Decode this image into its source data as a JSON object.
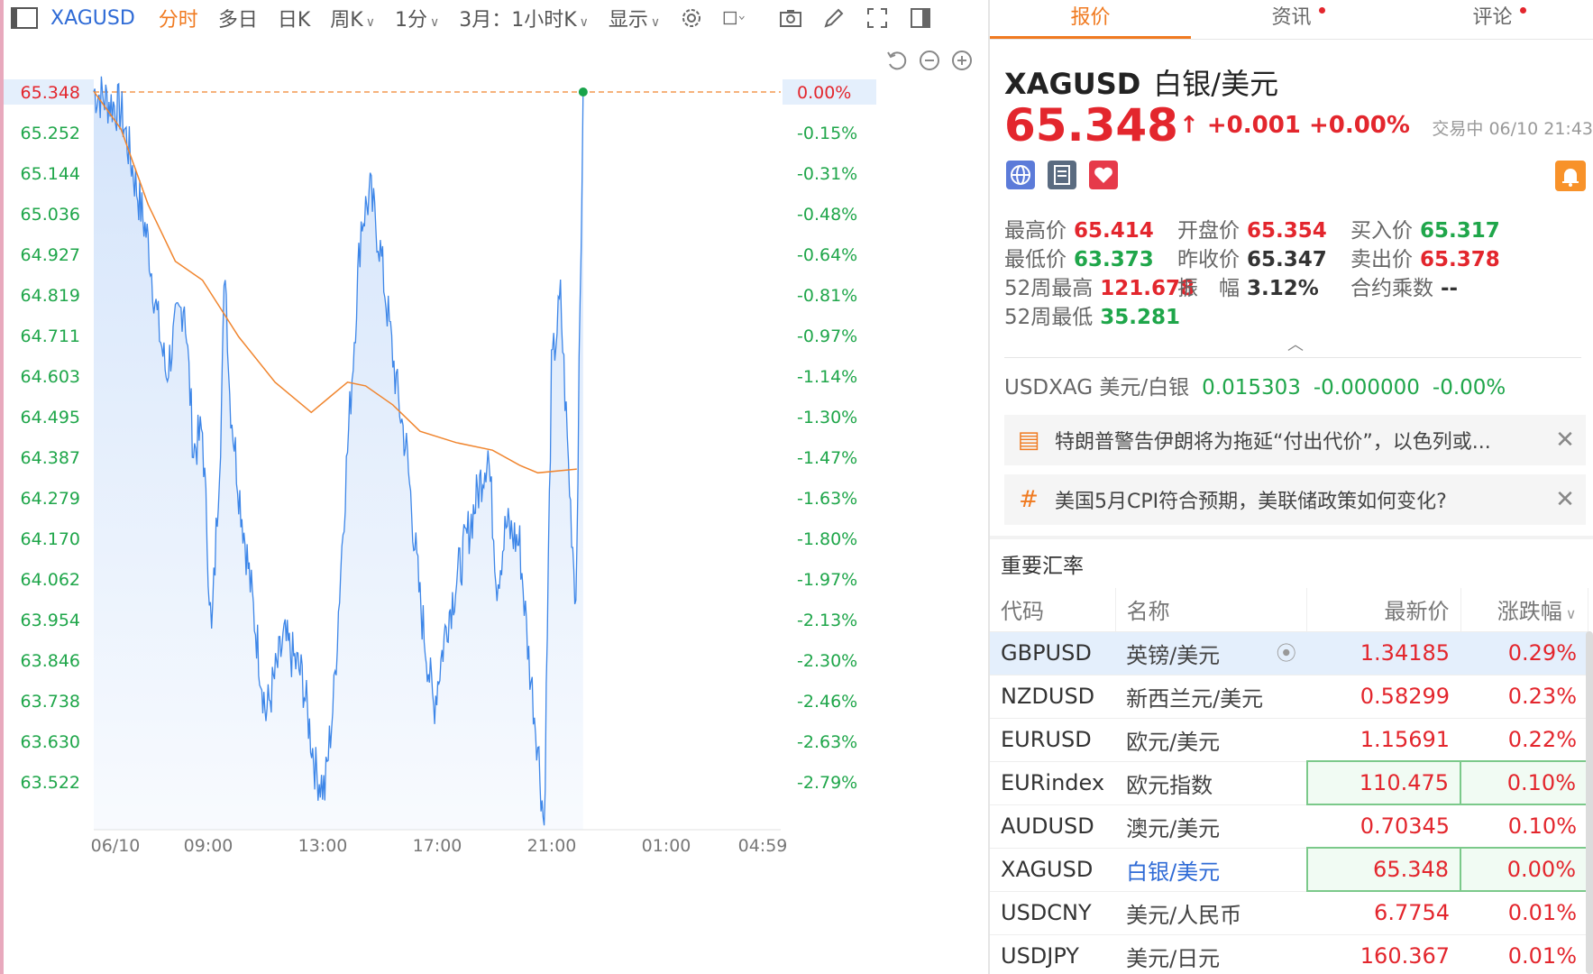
{
  "toolbar": {
    "symbol": "XAGUSD",
    "items": [
      "分时",
      "多日",
      "日K",
      "周K",
      "1分",
      "3月：1小时K",
      "显示"
    ],
    "active_index": 0
  },
  "chart": {
    "price_labels": [
      "65.348",
      "65.252",
      "65.144",
      "65.036",
      "64.927",
      "64.819",
      "64.711",
      "64.603",
      "64.495",
      "64.387",
      "64.279",
      "64.170",
      "64.062",
      "63.954",
      "63.846",
      "63.738",
      "63.630",
      "63.522"
    ],
    "pct_labels": [
      "0.00%",
      "-0.15%",
      "-0.31%",
      "-0.48%",
      "-0.64%",
      "-0.81%",
      "-0.97%",
      "-1.14%",
      "-1.30%",
      "-1.47%",
      "-1.63%",
      "-1.80%",
      "-1.97%",
      "-2.13%",
      "-2.30%",
      "-2.46%",
      "-2.63%",
      "-2.79%"
    ],
    "time_labels": [
      "06/10",
      "09:00",
      "13:00",
      "17:00",
      "21:00",
      "01:00",
      "04:59"
    ],
    "colors": {
      "line": "#3d86e8",
      "avg": "#f0852e",
      "up": "#e3262d",
      "down": "#1fa64a",
      "fill": "#cfe1fa"
    }
  },
  "panel": {
    "tabs": [
      {
        "label": "报价",
        "active": true,
        "dot": false
      },
      {
        "label": "资讯",
        "active": false,
        "dot": true
      },
      {
        "label": "评论",
        "active": false,
        "dot": true
      }
    ],
    "quote": {
      "symbol": "XAGUSD",
      "name": "白银/美元",
      "price": "65.348",
      "arrow": "↑",
      "change": "+0.001",
      "change_pct": "+0.00%",
      "status": "交易中 06/10 21:43"
    },
    "stats": [
      {
        "label": "最高价",
        "value": "65.414",
        "tone": "up"
      },
      {
        "label": "开盘价",
        "value": "65.354",
        "tone": "up"
      },
      {
        "label": "买入价",
        "value": "65.317",
        "tone": "down"
      },
      {
        "label": "最低价",
        "value": "63.373",
        "tone": "down"
      },
      {
        "label": "昨收价",
        "value": "65.347",
        "tone": "neutral"
      },
      {
        "label": "卖出价",
        "value": "65.378",
        "tone": "up"
      },
      {
        "label": "52周最高",
        "value": "121.678",
        "tone": "up"
      },
      {
        "label": "振　幅",
        "value": "3.12%",
        "tone": "neutral"
      },
      {
        "label": "合约乘数",
        "value": "--",
        "tone": "neutral"
      },
      {
        "label": "52周最低",
        "value": "35.281",
        "tone": "down"
      }
    ],
    "usdxag": {
      "label": "USDXAG 美元/白银",
      "price": "0.015303",
      "change": "-0.000000",
      "pct": "-0.00%"
    },
    "news": [
      {
        "text": "特朗普警告伊朗将为拖延“付出代价”，以色列或...",
        "icon": "document-icon"
      },
      {
        "text": "美国5月CPI符合预期，美联储政策如何变化?",
        "icon": "hashtag-icon"
      }
    ],
    "rates": {
      "title": "重要汇率",
      "headers": [
        "代码",
        "名称",
        "最新价",
        "涨跌幅"
      ],
      "rows": [
        {
          "code": "GBPUSD",
          "name": "英镑/美元",
          "price": "1.34185",
          "pct": "0.29%",
          "selected": true
        },
        {
          "code": "NZDUSD",
          "name": "新西兰元/美元",
          "price": "0.58299",
          "pct": "0.23%"
        },
        {
          "code": "EURUSD",
          "name": "欧元/美元",
          "price": "1.15691",
          "pct": "0.22%"
        },
        {
          "code": "EURindex",
          "name": "欧元指数",
          "price": "110.475",
          "pct": "0.10%",
          "highlight": true
        },
        {
          "code": "AUDUSD",
          "name": "澳元/美元",
          "price": "0.70345",
          "pct": "0.10%"
        },
        {
          "code": "XAGUSD",
          "name": "白银/美元",
          "price": "65.348",
          "pct": "0.00%",
          "highlight": true,
          "link": true
        },
        {
          "code": "USDCNY",
          "name": "美元/人民币",
          "price": "6.7754",
          "pct": "0.01%"
        },
        {
          "code": "USDJPY",
          "name": "美元/日元",
          "price": "160.367",
          "pct": "0.01%"
        }
      ]
    }
  }
}
